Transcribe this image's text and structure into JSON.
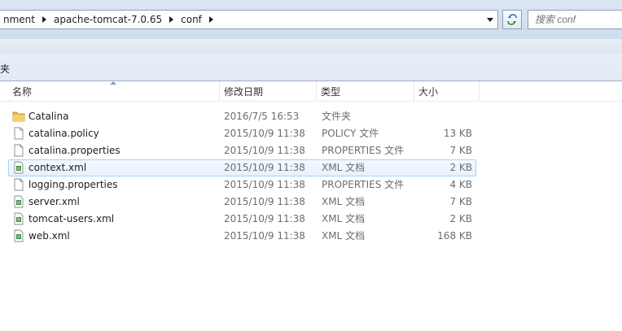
{
  "address": {
    "crumbs": [
      "nment",
      "apache-tomcat-7.0.65",
      "conf"
    ]
  },
  "search": {
    "placeholder": "搜索 conf"
  },
  "toolbar": {
    "item": "夹"
  },
  "columns": {
    "name": "名称",
    "date": "修改日期",
    "type": "类型",
    "size": "大小"
  },
  "files": [
    {
      "name": "Catalina",
      "date": "2016/7/5 16:53",
      "type": "文件夹",
      "size": "",
      "icon": "folder-icon"
    },
    {
      "name": "catalina.policy",
      "date": "2015/10/9 11:38",
      "type": "POLICY 文件",
      "size": "13 KB",
      "icon": "file-icon"
    },
    {
      "name": "catalina.properties",
      "date": "2015/10/9 11:38",
      "type": "PROPERTIES 文件",
      "size": "7 KB",
      "icon": "file-icon"
    },
    {
      "name": "context.xml",
      "date": "2015/10/9 11:38",
      "type": "XML 文档",
      "size": "2 KB",
      "icon": "xml-file-icon"
    },
    {
      "name": "logging.properties",
      "date": "2015/10/9 11:38",
      "type": "PROPERTIES 文件",
      "size": "4 KB",
      "icon": "file-icon"
    },
    {
      "name": "server.xml",
      "date": "2015/10/9 11:38",
      "type": "XML 文档",
      "size": "7 KB",
      "icon": "xml-file-icon"
    },
    {
      "name": "tomcat-users.xml",
      "date": "2015/10/9 11:38",
      "type": "XML 文档",
      "size": "2 KB",
      "icon": "xml-file-icon"
    },
    {
      "name": "web.xml",
      "date": "2015/10/9 11:38",
      "type": "XML 文档",
      "size": "168 KB",
      "icon": "xml-file-icon"
    }
  ]
}
